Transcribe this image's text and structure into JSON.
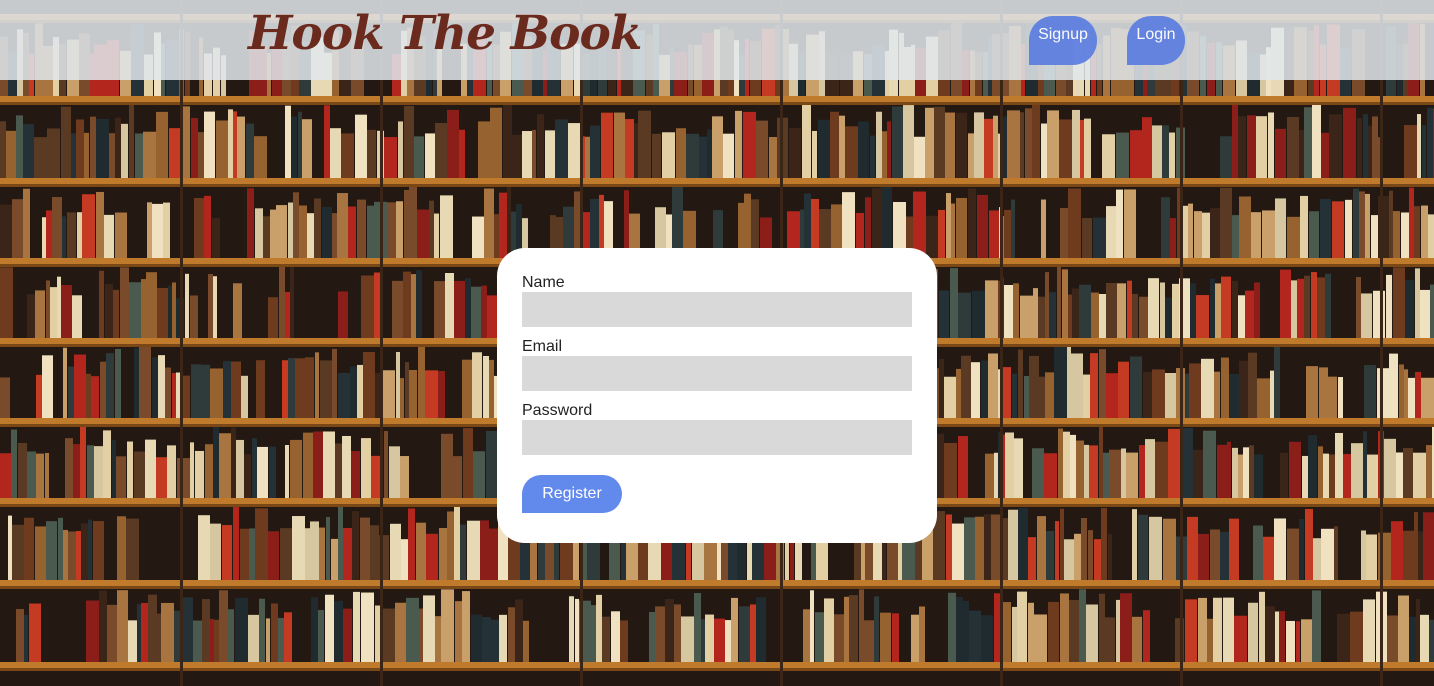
{
  "header": {
    "brand": "Hook The Book",
    "nav": {
      "signup_label": "Signup",
      "login_label": "Login"
    }
  },
  "form": {
    "fields": {
      "name": {
        "label": "Name",
        "value": ""
      },
      "email": {
        "label": "Email",
        "value": ""
      },
      "password": {
        "label": "Password",
        "value": ""
      }
    },
    "submit_label": "Register"
  },
  "colors": {
    "header_bg": "#e1e8ec",
    "brand_text": "#6b2a1e",
    "nav_button": "#5b7de0",
    "register_button": "#6289ec",
    "input_bg": "#d9d9d9",
    "card_bg": "#ffffff"
  }
}
